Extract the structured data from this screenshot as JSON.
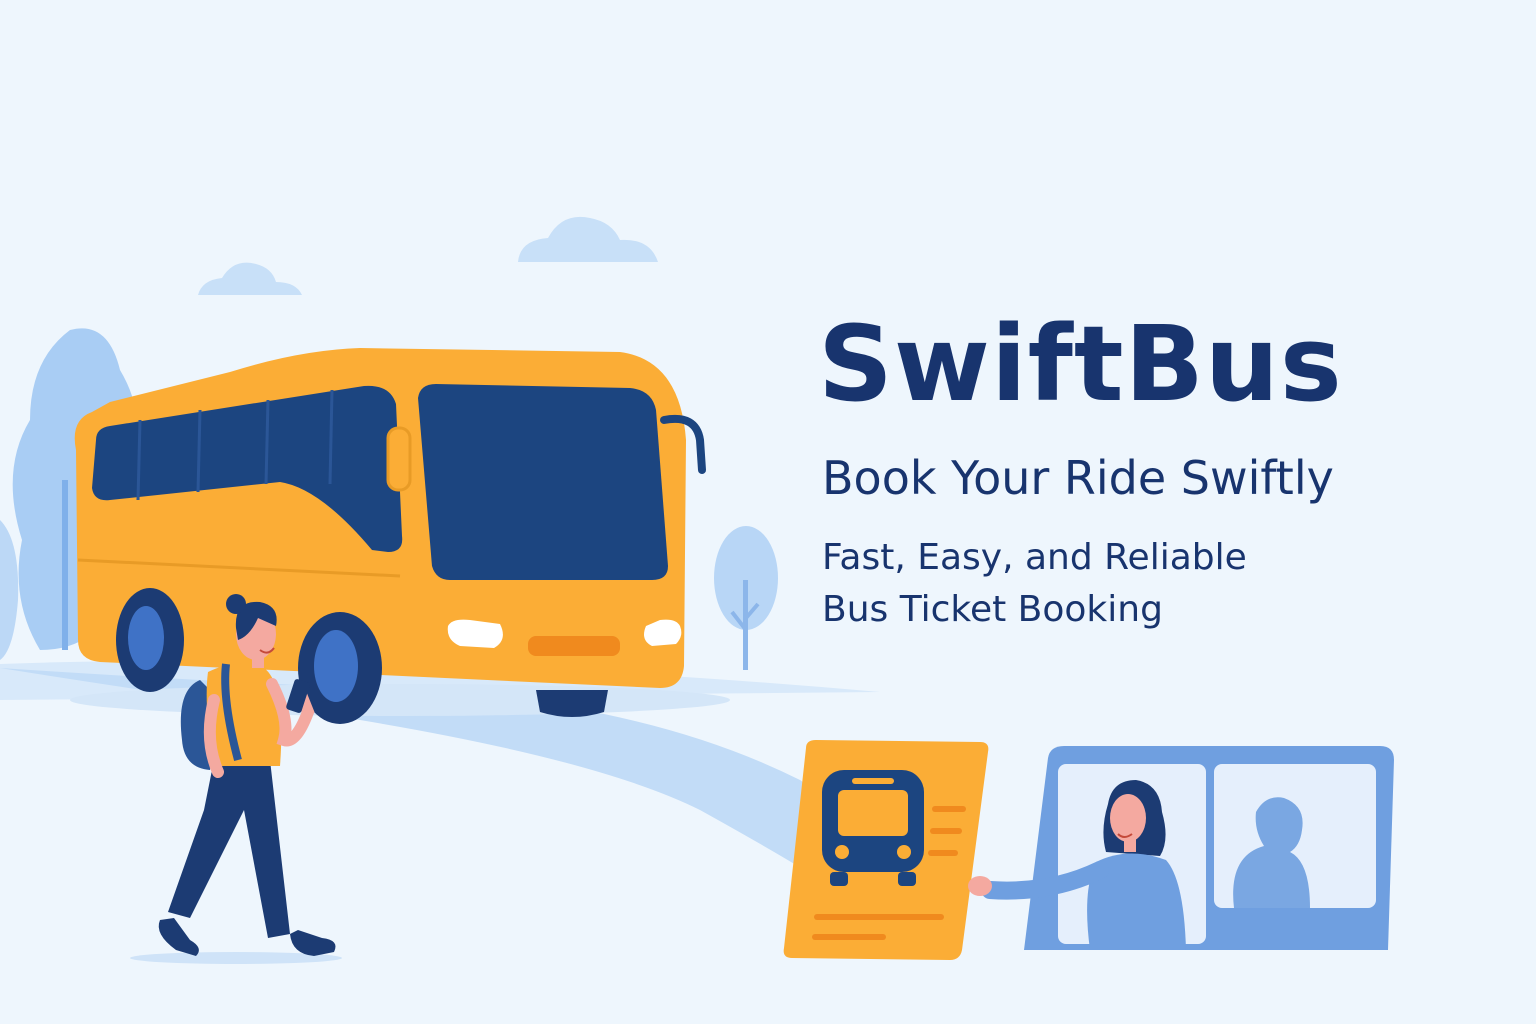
{
  "hero": {
    "brand_name": "SwiftBus",
    "tagline": "Book Your Ride Swiftly",
    "subtitle_lines": [
      "Fast, Easy, and Reliable",
      "Bus Ticket Booking"
    ]
  },
  "illustration": {
    "elements": [
      "clouds",
      "trees",
      "road",
      "yellow-bus",
      "walking-traveler-with-phone",
      "bus-ticket",
      "ticket-agent-window"
    ]
  },
  "colors": {
    "background": "#eef6fd",
    "brand_navy": "#18346e",
    "bus_yellow": "#fbad36",
    "window_blue": "#1c4580",
    "sky_blue": "#c8e0f8",
    "road_blue": "#c2dcf7",
    "agent_blue": "#6f9fe0"
  }
}
